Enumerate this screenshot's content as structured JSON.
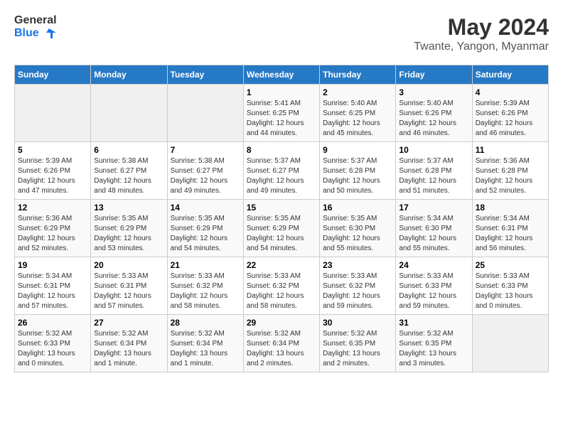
{
  "logo": {
    "line1": "General",
    "line2": "Blue"
  },
  "title": "May 2024",
  "subtitle": "Twante, Yangon, Myanmar",
  "days_of_week": [
    "Sunday",
    "Monday",
    "Tuesday",
    "Wednesday",
    "Thursday",
    "Friday",
    "Saturday"
  ],
  "weeks": [
    [
      {
        "day": "",
        "info": ""
      },
      {
        "day": "",
        "info": ""
      },
      {
        "day": "",
        "info": ""
      },
      {
        "day": "1",
        "info": "Sunrise: 5:41 AM\nSunset: 6:25 PM\nDaylight: 12 hours\nand 44 minutes."
      },
      {
        "day": "2",
        "info": "Sunrise: 5:40 AM\nSunset: 6:25 PM\nDaylight: 12 hours\nand 45 minutes."
      },
      {
        "day": "3",
        "info": "Sunrise: 5:40 AM\nSunset: 6:26 PM\nDaylight: 12 hours\nand 46 minutes."
      },
      {
        "day": "4",
        "info": "Sunrise: 5:39 AM\nSunset: 6:26 PM\nDaylight: 12 hours\nand 46 minutes."
      }
    ],
    [
      {
        "day": "5",
        "info": "Sunrise: 5:39 AM\nSunset: 6:26 PM\nDaylight: 12 hours\nand 47 minutes."
      },
      {
        "day": "6",
        "info": "Sunrise: 5:38 AM\nSunset: 6:27 PM\nDaylight: 12 hours\nand 48 minutes."
      },
      {
        "day": "7",
        "info": "Sunrise: 5:38 AM\nSunset: 6:27 PM\nDaylight: 12 hours\nand 49 minutes."
      },
      {
        "day": "8",
        "info": "Sunrise: 5:37 AM\nSunset: 6:27 PM\nDaylight: 12 hours\nand 49 minutes."
      },
      {
        "day": "9",
        "info": "Sunrise: 5:37 AM\nSunset: 6:28 PM\nDaylight: 12 hours\nand 50 minutes."
      },
      {
        "day": "10",
        "info": "Sunrise: 5:37 AM\nSunset: 6:28 PM\nDaylight: 12 hours\nand 51 minutes."
      },
      {
        "day": "11",
        "info": "Sunrise: 5:36 AM\nSunset: 6:28 PM\nDaylight: 12 hours\nand 52 minutes."
      }
    ],
    [
      {
        "day": "12",
        "info": "Sunrise: 5:36 AM\nSunset: 6:29 PM\nDaylight: 12 hours\nand 52 minutes."
      },
      {
        "day": "13",
        "info": "Sunrise: 5:35 AM\nSunset: 6:29 PM\nDaylight: 12 hours\nand 53 minutes."
      },
      {
        "day": "14",
        "info": "Sunrise: 5:35 AM\nSunset: 6:29 PM\nDaylight: 12 hours\nand 54 minutes."
      },
      {
        "day": "15",
        "info": "Sunrise: 5:35 AM\nSunset: 6:29 PM\nDaylight: 12 hours\nand 54 minutes."
      },
      {
        "day": "16",
        "info": "Sunrise: 5:35 AM\nSunset: 6:30 PM\nDaylight: 12 hours\nand 55 minutes."
      },
      {
        "day": "17",
        "info": "Sunrise: 5:34 AM\nSunset: 6:30 PM\nDaylight: 12 hours\nand 55 minutes."
      },
      {
        "day": "18",
        "info": "Sunrise: 5:34 AM\nSunset: 6:31 PM\nDaylight: 12 hours\nand 56 minutes."
      }
    ],
    [
      {
        "day": "19",
        "info": "Sunrise: 5:34 AM\nSunset: 6:31 PM\nDaylight: 12 hours\nand 57 minutes."
      },
      {
        "day": "20",
        "info": "Sunrise: 5:33 AM\nSunset: 6:31 PM\nDaylight: 12 hours\nand 57 minutes."
      },
      {
        "day": "21",
        "info": "Sunrise: 5:33 AM\nSunset: 6:32 PM\nDaylight: 12 hours\nand 58 minutes."
      },
      {
        "day": "22",
        "info": "Sunrise: 5:33 AM\nSunset: 6:32 PM\nDaylight: 12 hours\nand 58 minutes."
      },
      {
        "day": "23",
        "info": "Sunrise: 5:33 AM\nSunset: 6:32 PM\nDaylight: 12 hours\nand 59 minutes."
      },
      {
        "day": "24",
        "info": "Sunrise: 5:33 AM\nSunset: 6:33 PM\nDaylight: 12 hours\nand 59 minutes."
      },
      {
        "day": "25",
        "info": "Sunrise: 5:33 AM\nSunset: 6:33 PM\nDaylight: 13 hours\nand 0 minutes."
      }
    ],
    [
      {
        "day": "26",
        "info": "Sunrise: 5:32 AM\nSunset: 6:33 PM\nDaylight: 13 hours\nand 0 minutes."
      },
      {
        "day": "27",
        "info": "Sunrise: 5:32 AM\nSunset: 6:34 PM\nDaylight: 13 hours\nand 1 minute."
      },
      {
        "day": "28",
        "info": "Sunrise: 5:32 AM\nSunset: 6:34 PM\nDaylight: 13 hours\nand 1 minute."
      },
      {
        "day": "29",
        "info": "Sunrise: 5:32 AM\nSunset: 6:34 PM\nDaylight: 13 hours\nand 2 minutes."
      },
      {
        "day": "30",
        "info": "Sunrise: 5:32 AM\nSunset: 6:35 PM\nDaylight: 13 hours\nand 2 minutes."
      },
      {
        "day": "31",
        "info": "Sunrise: 5:32 AM\nSunset: 6:35 PM\nDaylight: 13 hours\nand 3 minutes."
      },
      {
        "day": "",
        "info": ""
      }
    ]
  ]
}
